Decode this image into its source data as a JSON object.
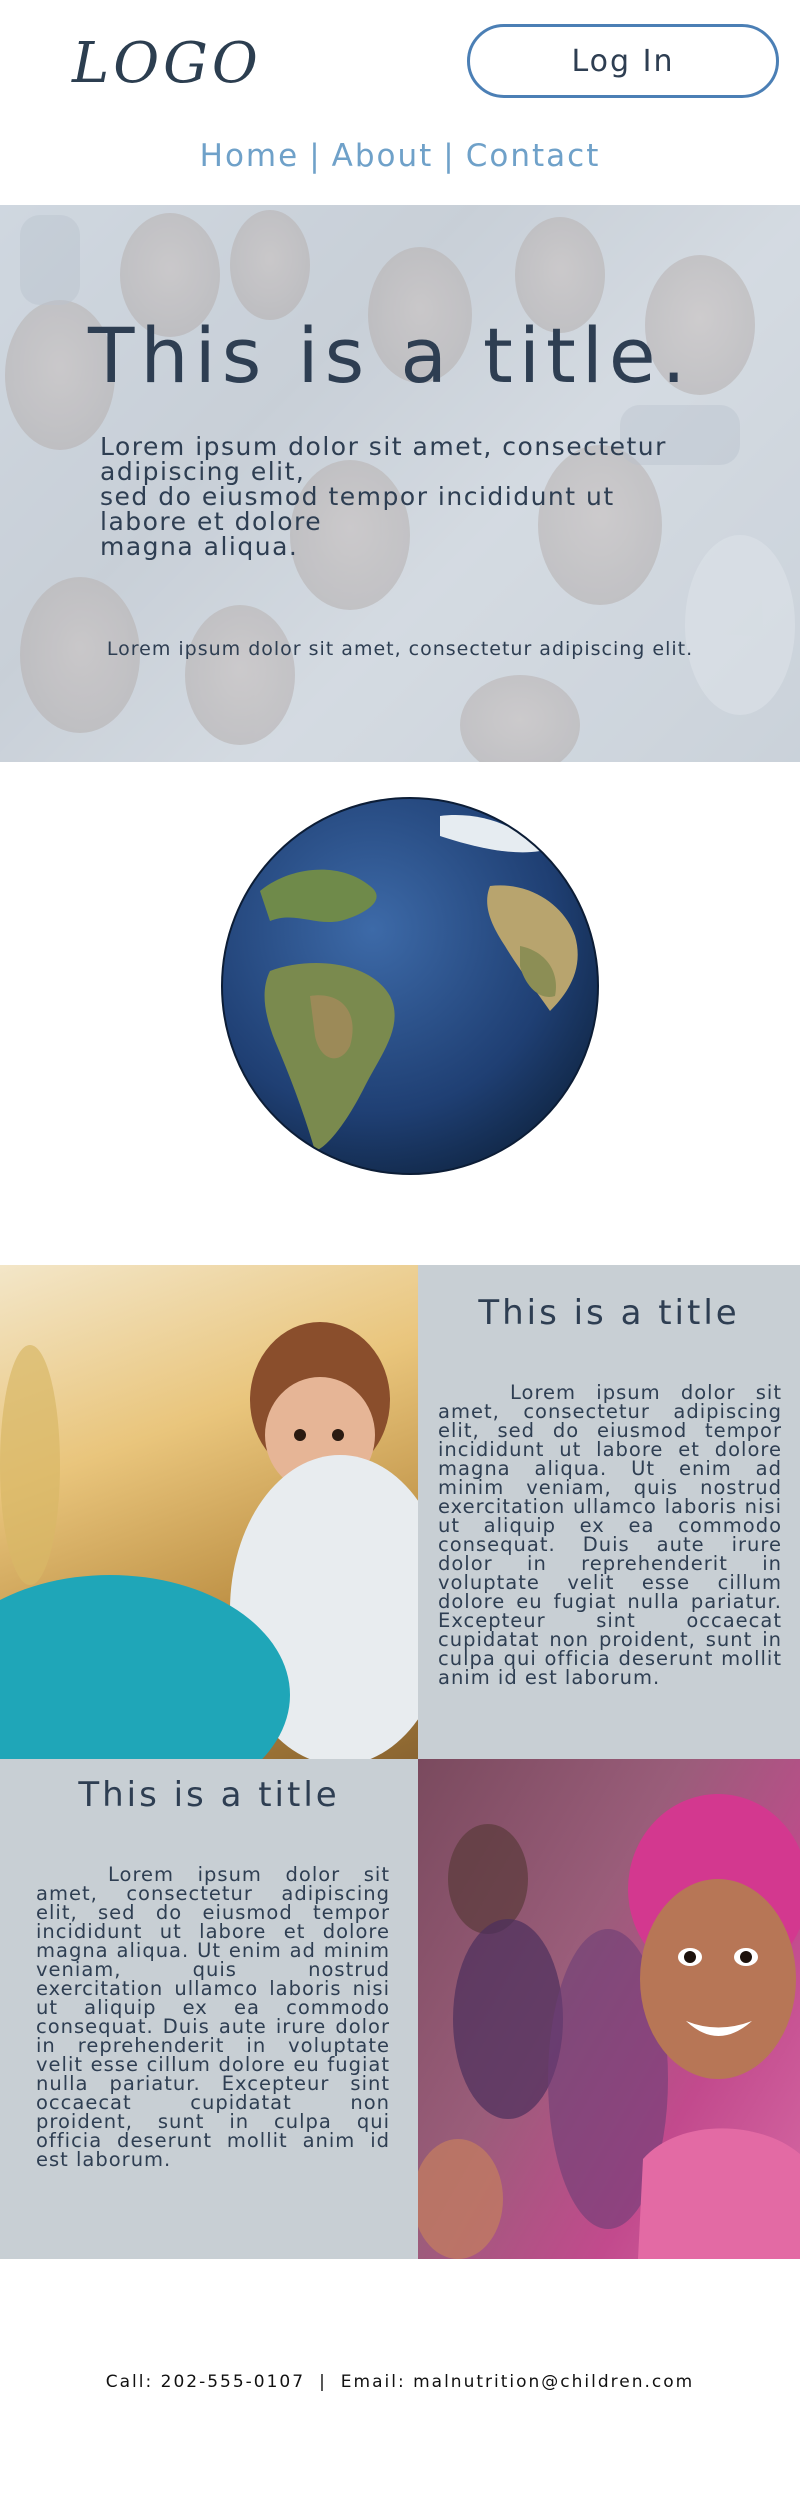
{
  "header": {
    "logo": "LOGO",
    "login_label": "Log In"
  },
  "nav": {
    "items": [
      "Home",
      "About",
      "Contact"
    ],
    "separator": "|"
  },
  "hero": {
    "title": "This is a title.",
    "body": "Lorem ipsum dolor sit amet, consectetur\nadipiscing elit,\n sed do eiusmod tempor incididunt ut\nlabore et dolore\n magna aliqua.",
    "small": "Lorem ipsum dolor sit amet, consectetur adipiscing elit."
  },
  "section1": {
    "title": "This is a title",
    "text": "Lorem ipsum dolor sit amet, consectetur adipiscing elit, sed do eiusmod tempor incididunt ut labore et dolore magna aliqua. Ut enim ad minim veniam, quis nostrud exercitation ullamco laboris nisi ut aliquip ex ea commodo consequat. Duis aute irure dolor in reprehenderit in voluptate velit esse cillum dolore eu fugiat nulla pariatur. Excepteur sint occaecat cupidatat non proident, sunt in culpa qui officia deserunt mollit anim id est laborum."
  },
  "section2": {
    "title": "This is a title",
    "text": "Lorem ipsum dolor sit amet, consectetur adipiscing elit, sed do eiusmod tempor incididunt ut labore et dolore magna aliqua. Ut enim ad minim veniam, quis nostrud exercitation ullamco laboris nisi ut aliquip ex ea commodo consequat. Duis aute irure dolor in reprehenderit in voluptate velit esse cillum dolore eu fugiat nulla pariatur. Excepteur sint occaecat cupidatat non proident, sunt in culpa qui officia deserunt mollit anim id est laborum."
  },
  "footer": {
    "call": "Call: 202-555-0107",
    "separator": "|",
    "email": "Email: malnutrition@children.com"
  },
  "colors": {
    "text": "#2e3e52",
    "nav": "#6fa1c9",
    "login_border": "#4b7fb5",
    "panel": "#c8cfd4"
  }
}
